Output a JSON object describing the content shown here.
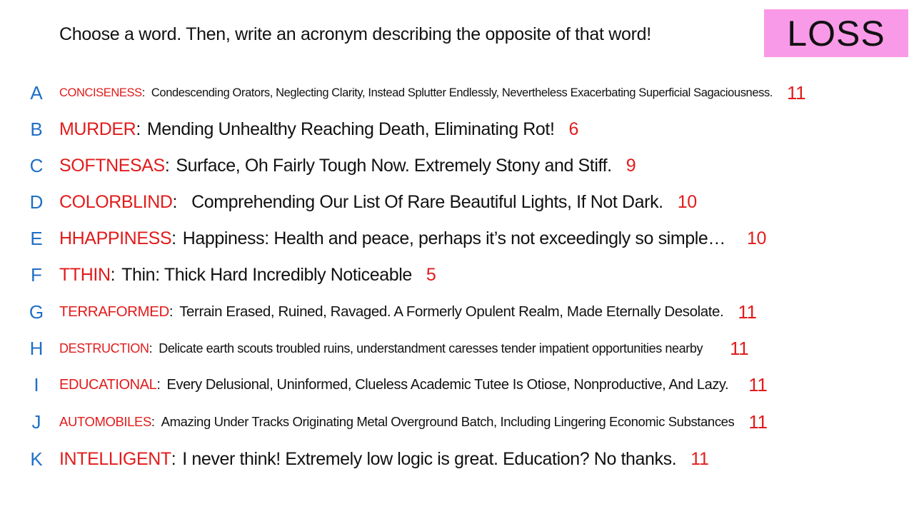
{
  "header": {
    "instructions": "Choose a word. Then, write an acronym describing the opposite of that word!",
    "badge": "LOSS"
  },
  "colors": {
    "letter": "#1f6fc6",
    "word": "#e21b1b",
    "badge_bg": "#f99ae8"
  },
  "entries": [
    {
      "letter": "A",
      "word": "CONCISENESS",
      "colon": ":",
      "acronym": "Condescending Orators, Neglecting Clarity, Instead Splutter Endlessly, Nevertheless Exacerbating Superficial Sagaciousness.",
      "count": "11"
    },
    {
      "letter": "B",
      "word": "MURDER",
      "colon": ":",
      "acronym": "Mending Unhealthy Reaching Death, Eliminating Rot!",
      "count": "6"
    },
    {
      "letter": "C",
      "word": "SOFTNESAS",
      "colon": ":",
      "acronym": "Surface, Oh Fairly Tough Now. Extremely Stony and Stiff.",
      "count": "9"
    },
    {
      "letter": "D",
      "word": "COLORBLIND",
      "colon": ":",
      "acronym": "Comprehending Our List Of Rare Beautiful Lights, If Not Dark.",
      "count": "10"
    },
    {
      "letter": "E",
      "word": "HHAPPINESS",
      "colon": ":",
      "acronym": "Happiness: Health and peace, perhaps it’s not exceedingly so simple…",
      "count": "10"
    },
    {
      "letter": "F",
      "word": "TTHIN",
      "colon": ":",
      "acronym": "Thin: Thick Hard Incredibly Noticeable",
      "count": "5"
    },
    {
      "letter": "G",
      "word": "TERRAFORMED",
      "colon": ":",
      "acronym": "Terrain Erased, Ruined, Ravaged. A Formerly Opulent Realm, Made Eternally Desolate.",
      "count": "11"
    },
    {
      "letter": "H",
      "word": "DESTRUCTION",
      "colon": ":",
      "acronym": "Delicate earth scouts troubled ruins, understandment caresses tender impatient opportunities nearby",
      "count": "11"
    },
    {
      "letter": "I",
      "word": "EDUCATIONAL",
      "colon": ":",
      "acronym": "Every Delusional, Uninformed, Clueless Academic Tutee Is Otiose, Nonproductive, And Lazy.",
      "count": "11"
    },
    {
      "letter": "J",
      "word": "AUTOMOBILES",
      "colon": ":",
      "acronym": "Amazing Under Tracks Originating Metal Overground Batch, Including Lingering Economic Substances",
      "count": "11"
    },
    {
      "letter": "K",
      "word": "INTELLIGENT",
      "colon": ":",
      "acronym": "I never think! Extremely low logic is great. Education? No thanks.",
      "count": "11"
    }
  ]
}
